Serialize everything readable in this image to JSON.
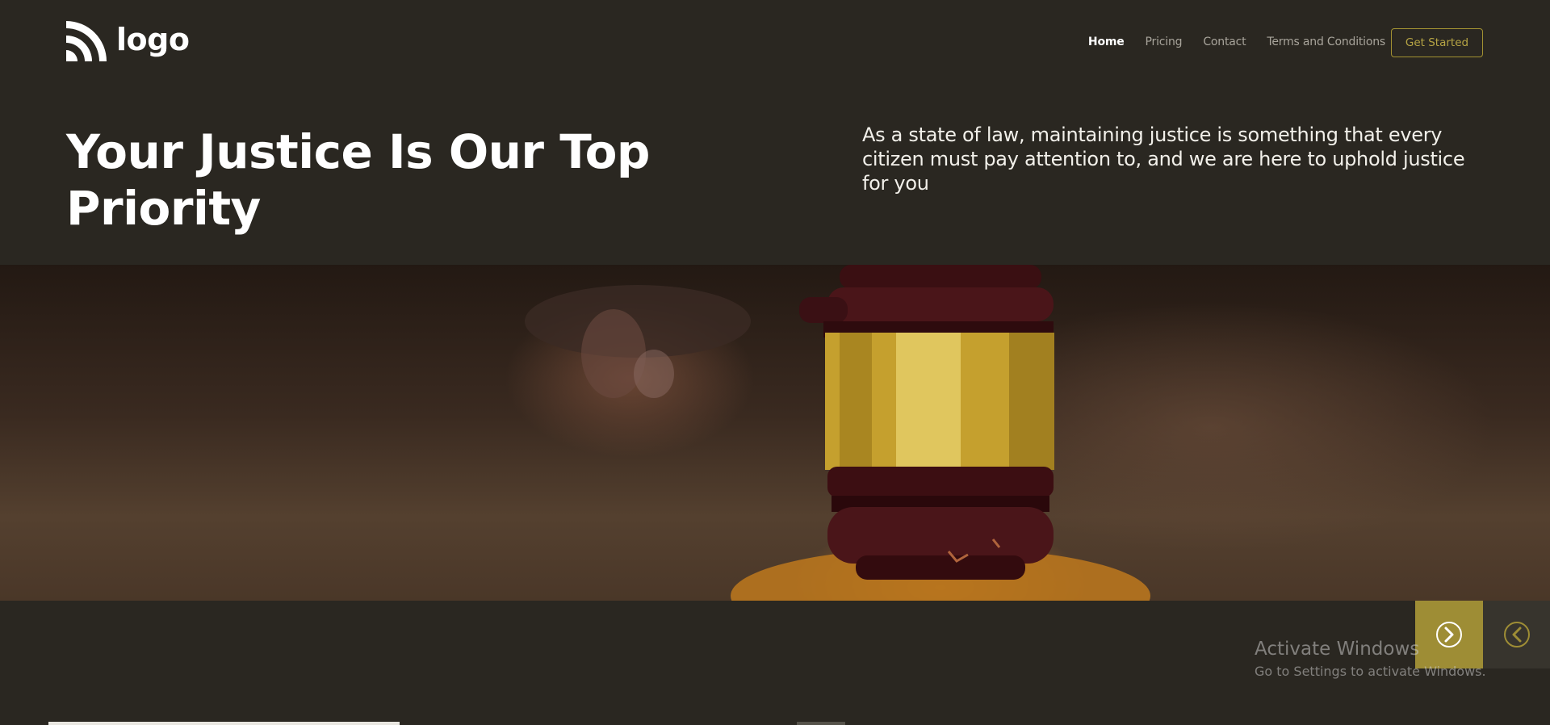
{
  "brand": {
    "logo_text": "logo",
    "accent": "#9e8d35",
    "background": "#2a2721"
  },
  "nav": {
    "items": [
      {
        "label": "Home",
        "active": true
      },
      {
        "label": "Pricing",
        "active": false
      },
      {
        "label": "Contact",
        "active": false
      },
      {
        "label": "Terms and Conditions",
        "active": false
      }
    ],
    "cta_label": "Get Started"
  },
  "hero": {
    "title": "Your Justice Is Our Top Priority",
    "description": "As a state of law, maintaining justice is something that every citizen must pay attention to, and we are here to uphold justice for you"
  },
  "slider": {
    "next_icon": "chevron-right-circle-icon",
    "prev_icon": "chevron-left-circle-icon",
    "progress": 0.44
  },
  "watermark": {
    "title": "Activate Windows",
    "subtitle": "Go to Settings to activate Windows."
  }
}
